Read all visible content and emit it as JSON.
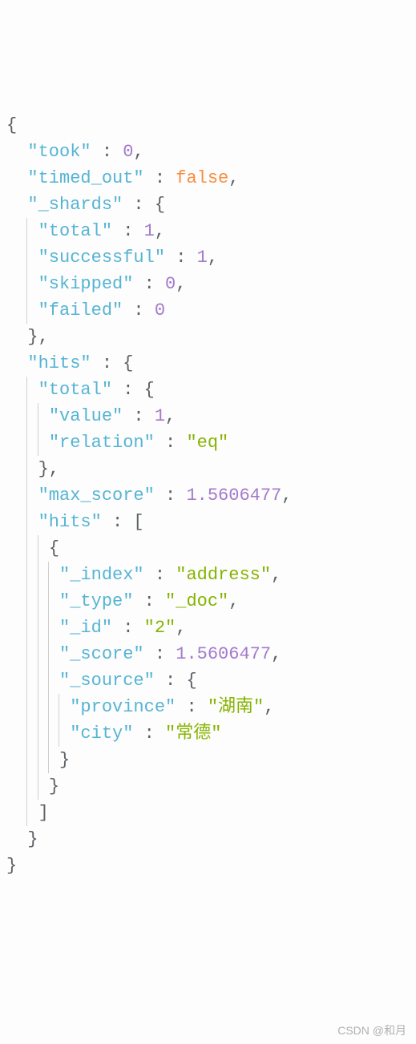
{
  "code": {
    "lines": [
      {
        "indent": 0,
        "tokens": [
          {
            "t": "punct",
            "v": "{"
          }
        ]
      },
      {
        "indent": 1,
        "tokens": [
          {
            "t": "key",
            "v": "\"took\""
          },
          {
            "t": "punct",
            "v": " : "
          },
          {
            "t": "num",
            "v": "0"
          },
          {
            "t": "punct",
            "v": ","
          }
        ]
      },
      {
        "indent": 1,
        "tokens": [
          {
            "t": "key",
            "v": "\"timed_out\""
          },
          {
            "t": "punct",
            "v": " : "
          },
          {
            "t": "bool",
            "v": "false"
          },
          {
            "t": "punct",
            "v": ","
          }
        ]
      },
      {
        "indent": 1,
        "tokens": [
          {
            "t": "key",
            "v": "\"_shards\""
          },
          {
            "t": "punct",
            "v": " : {"
          }
        ]
      },
      {
        "indent": 2,
        "guide": true,
        "tokens": [
          {
            "t": "key",
            "v": "\"total\""
          },
          {
            "t": "punct",
            "v": " : "
          },
          {
            "t": "num",
            "v": "1"
          },
          {
            "t": "punct",
            "v": ","
          }
        ]
      },
      {
        "indent": 2,
        "guide": true,
        "tokens": [
          {
            "t": "key",
            "v": "\"successful\""
          },
          {
            "t": "punct",
            "v": " : "
          },
          {
            "t": "num",
            "v": "1"
          },
          {
            "t": "punct",
            "v": ","
          }
        ]
      },
      {
        "indent": 2,
        "guide": true,
        "tokens": [
          {
            "t": "key",
            "v": "\"skipped\""
          },
          {
            "t": "punct",
            "v": " : "
          },
          {
            "t": "num",
            "v": "0"
          },
          {
            "t": "punct",
            "v": ","
          }
        ]
      },
      {
        "indent": 2,
        "guide": true,
        "tokens": [
          {
            "t": "key",
            "v": "\"failed\""
          },
          {
            "t": "punct",
            "v": " : "
          },
          {
            "t": "num",
            "v": "0"
          }
        ]
      },
      {
        "indent": 1,
        "tokens": [
          {
            "t": "punct",
            "v": "},"
          }
        ]
      },
      {
        "indent": 1,
        "tokens": [
          {
            "t": "key",
            "v": "\"hits\""
          },
          {
            "t": "punct",
            "v": " : {"
          }
        ]
      },
      {
        "indent": 2,
        "guide": true,
        "tokens": [
          {
            "t": "key",
            "v": "\"total\""
          },
          {
            "t": "punct",
            "v": " : {"
          }
        ]
      },
      {
        "indent": 3,
        "guide2": true,
        "tokens": [
          {
            "t": "key",
            "v": "\"value\""
          },
          {
            "t": "punct",
            "v": " : "
          },
          {
            "t": "num",
            "v": "1"
          },
          {
            "t": "punct",
            "v": ","
          }
        ]
      },
      {
        "indent": 3,
        "guide2": true,
        "tokens": [
          {
            "t": "key",
            "v": "\"relation\""
          },
          {
            "t": "punct",
            "v": " : "
          },
          {
            "t": "str",
            "v": "\"eq\""
          }
        ]
      },
      {
        "indent": 2,
        "guide": true,
        "tokens": [
          {
            "t": "punct",
            "v": "},"
          }
        ]
      },
      {
        "indent": 2,
        "guide": true,
        "tokens": [
          {
            "t": "key",
            "v": "\"max_score\""
          },
          {
            "t": "punct",
            "v": " : "
          },
          {
            "t": "num",
            "v": "1.5606477"
          },
          {
            "t": "punct",
            "v": ","
          }
        ]
      },
      {
        "indent": 2,
        "guide": true,
        "tokens": [
          {
            "t": "key",
            "v": "\"hits\""
          },
          {
            "t": "punct",
            "v": " : ["
          }
        ]
      },
      {
        "indent": 3,
        "guide2": true,
        "tokens": [
          {
            "t": "punct",
            "v": "{"
          }
        ]
      },
      {
        "indent": 4,
        "guide3": true,
        "tokens": [
          {
            "t": "key",
            "v": "\"_index\""
          },
          {
            "t": "punct",
            "v": " : "
          },
          {
            "t": "str",
            "v": "\"address\""
          },
          {
            "t": "punct",
            "v": ","
          }
        ]
      },
      {
        "indent": 4,
        "guide3": true,
        "tokens": [
          {
            "t": "key",
            "v": "\"_type\""
          },
          {
            "t": "punct",
            "v": " : "
          },
          {
            "t": "str",
            "v": "\"_doc\""
          },
          {
            "t": "punct",
            "v": ","
          }
        ]
      },
      {
        "indent": 4,
        "guide3": true,
        "tokens": [
          {
            "t": "key",
            "v": "\"_id\""
          },
          {
            "t": "punct",
            "v": " : "
          },
          {
            "t": "str",
            "v": "\"2\""
          },
          {
            "t": "punct",
            "v": ","
          }
        ]
      },
      {
        "indent": 4,
        "guide3": true,
        "tokens": [
          {
            "t": "key",
            "v": "\"_score\""
          },
          {
            "t": "punct",
            "v": " : "
          },
          {
            "t": "num",
            "v": "1.5606477"
          },
          {
            "t": "punct",
            "v": ","
          }
        ]
      },
      {
        "indent": 4,
        "guide3": true,
        "tokens": [
          {
            "t": "key",
            "v": "\"_source\""
          },
          {
            "t": "punct",
            "v": " : {"
          }
        ]
      },
      {
        "indent": 5,
        "guide4": true,
        "tokens": [
          {
            "t": "key",
            "v": "\"province\""
          },
          {
            "t": "punct",
            "v": " : "
          },
          {
            "t": "str",
            "v": "\"湖南\""
          },
          {
            "t": "punct",
            "v": ","
          }
        ]
      },
      {
        "indent": 5,
        "guide4": true,
        "tokens": [
          {
            "t": "key",
            "v": "\"city\""
          },
          {
            "t": "punct",
            "v": " : "
          },
          {
            "t": "str",
            "v": "\"常德\""
          }
        ]
      },
      {
        "indent": 4,
        "guide3": true,
        "tokens": [
          {
            "t": "punct",
            "v": "}"
          }
        ]
      },
      {
        "indent": 3,
        "guide2": true,
        "tokens": [
          {
            "t": "punct",
            "v": "}"
          }
        ]
      },
      {
        "indent": 2,
        "guide": true,
        "tokens": [
          {
            "t": "punct",
            "v": "]"
          }
        ]
      },
      {
        "indent": 1,
        "tokens": [
          {
            "t": "punct",
            "v": "}"
          }
        ]
      },
      {
        "indent": 0,
        "tokens": [
          {
            "t": "punct",
            "v": "}"
          }
        ]
      }
    ]
  },
  "watermark": "CSDN @和月"
}
